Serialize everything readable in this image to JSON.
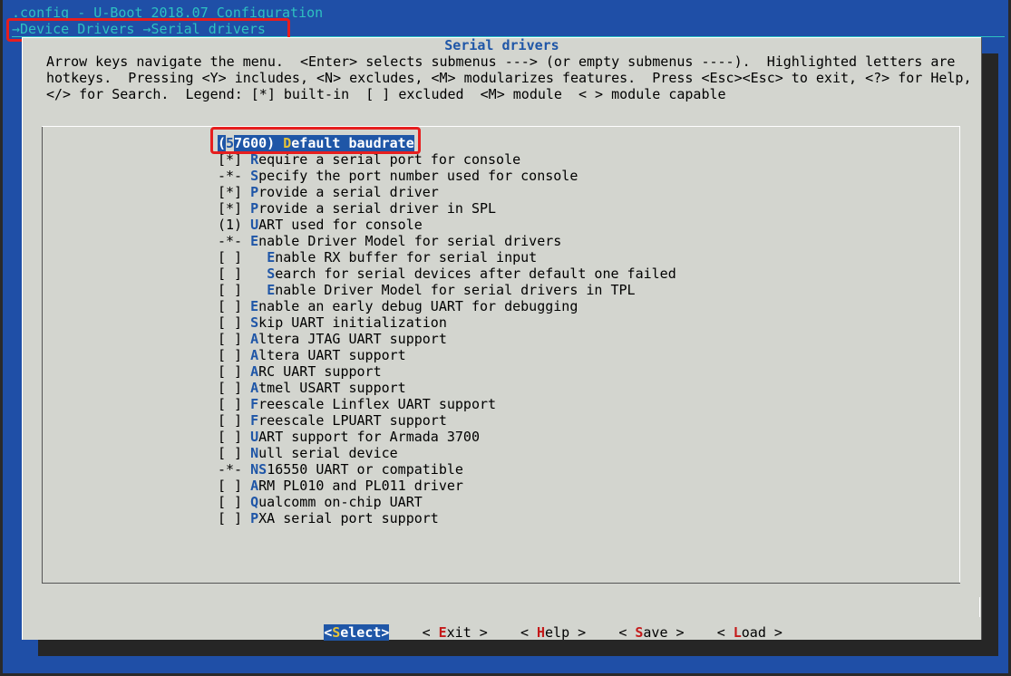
{
  "window": {
    "title": ".config - U-Boot 2018.07 Configuration",
    "breadcrumb": "→Device Drivers →Serial drivers"
  },
  "dialog": {
    "title": "Serial drivers",
    "help_lines": [
      "Arrow keys navigate the menu.  <Enter> selects submenus ---> (or empty submenus ----).  Highlighted letters are",
      "hotkeys.  Pressing <Y> includes, <N> excludes, <M> modularizes features.  Press <Esc><Esc> to exit, <?> for Help,",
      "</> for Search.  Legend: [*] built-in  [ ] excluded  <M> module  < > module capable"
    ]
  },
  "menu": {
    "selected": {
      "prefix": "(",
      "cursor": "5",
      "value_rest": "7600) ",
      "hotkey": "D",
      "label_rest": "efault baudrate"
    },
    "items": [
      {
        "prefix": "[*] ",
        "indent": "",
        "hotkey": "R",
        "rest": "equire a serial port for console"
      },
      {
        "prefix": "-*- ",
        "indent": "",
        "hotkey": "S",
        "rest": "pecify the port number used for console"
      },
      {
        "prefix": "[*] ",
        "indent": "",
        "hotkey": "P",
        "rest": "rovide a serial driver"
      },
      {
        "prefix": "[*] ",
        "indent": "",
        "hotkey": "P",
        "rest": "rovide a serial driver in SPL"
      },
      {
        "prefix": "(1) ",
        "indent": "",
        "hotkey": "U",
        "rest": "ART used for console"
      },
      {
        "prefix": "-*- ",
        "indent": "",
        "hotkey": "E",
        "rest": "nable Driver Model for serial drivers"
      },
      {
        "prefix": "[ ] ",
        "indent": "  ",
        "hotkey": "E",
        "rest": "nable RX buffer for serial input"
      },
      {
        "prefix": "[ ] ",
        "indent": "  ",
        "hotkey": "S",
        "rest": "earch for serial devices after default one failed"
      },
      {
        "prefix": "[ ] ",
        "indent": "  ",
        "hotkey": "E",
        "rest": "nable Driver Model for serial drivers in TPL"
      },
      {
        "prefix": "[ ] ",
        "indent": "",
        "hotkey": "E",
        "rest": "nable an early debug UART for debugging"
      },
      {
        "prefix": "[ ] ",
        "indent": "",
        "hotkey": "S",
        "rest": "kip UART initialization"
      },
      {
        "prefix": "[ ] ",
        "indent": "",
        "hotkey": "A",
        "rest": "ltera JTAG UART support"
      },
      {
        "prefix": "[ ] ",
        "indent": "",
        "hotkey": "A",
        "rest": "ltera UART support"
      },
      {
        "prefix": "[ ] ",
        "indent": "",
        "hotkey": "A",
        "rest": "RC UART support"
      },
      {
        "prefix": "[ ] ",
        "indent": "",
        "hotkey": "A",
        "rest": "tmel USART support"
      },
      {
        "prefix": "[ ] ",
        "indent": "",
        "hotkey": "F",
        "rest": "reescale Linflex UART support"
      },
      {
        "prefix": "[ ] ",
        "indent": "",
        "hotkey": "F",
        "rest": "reescale LPUART support"
      },
      {
        "prefix": "[ ] ",
        "indent": "",
        "hotkey": "U",
        "rest": "ART support for Armada 3700"
      },
      {
        "prefix": "[ ] ",
        "indent": "",
        "hotkey": "N",
        "rest": "ull serial device"
      },
      {
        "prefix": "-*- ",
        "indent": "",
        "hotkey": "NS",
        "rest": "16550 UART or compatible"
      },
      {
        "prefix": "[ ] ",
        "indent": "",
        "hotkey": "A",
        "rest": "RM PL010 and PL011 driver"
      },
      {
        "prefix": "[ ] ",
        "indent": "",
        "hotkey": "Q",
        "rest": "ualcomm on-chip UART"
      },
      {
        "prefix": "[ ] ",
        "indent": "",
        "hotkey": "P",
        "rest": "XA serial port support"
      }
    ]
  },
  "buttons": {
    "select": {
      "open": "<",
      "hotkey": "S",
      "rest": "elect",
      "close": ">"
    },
    "exit": {
      "open": "< ",
      "hotkey": "E",
      "rest": "xit",
      "close": " >"
    },
    "help": {
      "open": "< ",
      "hotkey": "H",
      "rest": "elp",
      "close": " >"
    },
    "save": {
      "open": "< ",
      "hotkey": "S",
      "rest": "ave",
      "close": " >"
    },
    "load": {
      "open": "< ",
      "hotkey": "L",
      "rest": "oad",
      "close": " >"
    }
  },
  "colors": {
    "background": "#1f4fa7",
    "dialog": "#d3d5cf",
    "accent": "#1f56a7",
    "hotkey_selected": "#e5c23a",
    "button_hotkey": "#c41a1a",
    "annotation": "#e61e1e",
    "title_text": "#2ec1c1"
  }
}
